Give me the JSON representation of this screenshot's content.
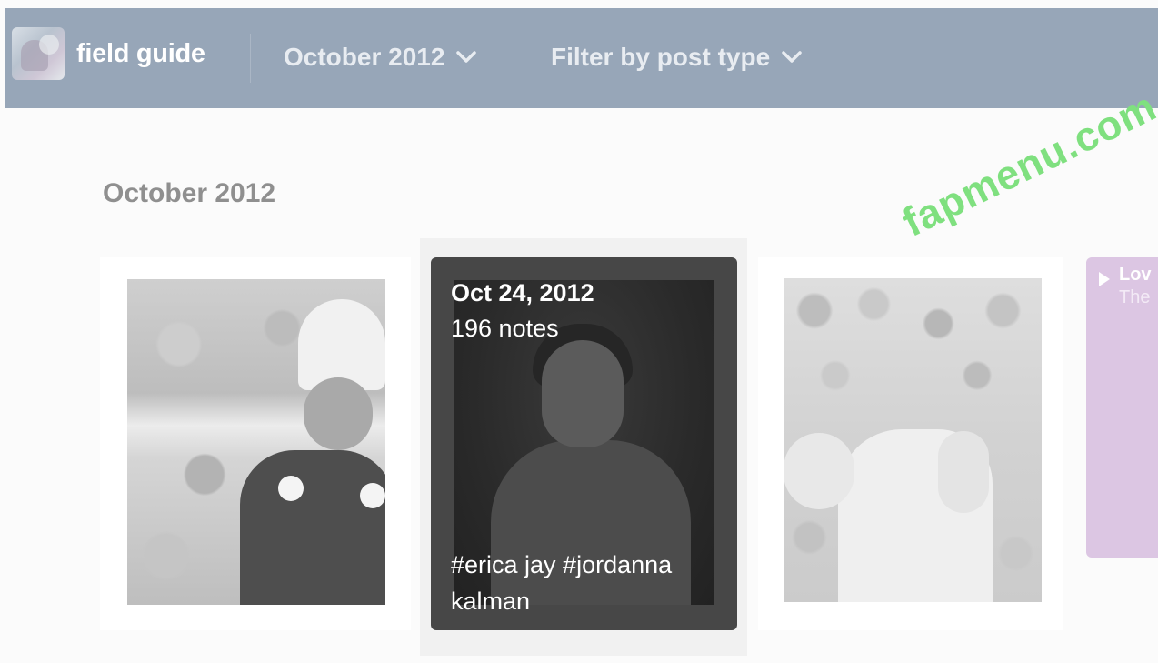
{
  "header": {
    "blog_title": "field guide",
    "month_selector": "October 2012",
    "filter_label": "Filter by post type"
  },
  "watermark": "fapmenu.com",
  "main": {
    "section_title": "October 2012",
    "posts": [
      {
        "kind": "photo",
        "alt": "child in costume photo"
      },
      {
        "kind": "photo",
        "date": "Oct 24, 2012",
        "notes": "196 notes",
        "tags": "#erica jay #jordanna kalman"
      },
      {
        "kind": "photo",
        "alt": "woman lying in flowers photo"
      },
      {
        "kind": "audio",
        "title": "Lov",
        "artist": "The"
      }
    ]
  },
  "colors": {
    "header_bg": "#97a6b8",
    "page_bg": "#fbfbfb",
    "hover_card_bg": "#474747",
    "audio_card_bg": "#dcc6e3",
    "watermark": "#7fe07f"
  }
}
